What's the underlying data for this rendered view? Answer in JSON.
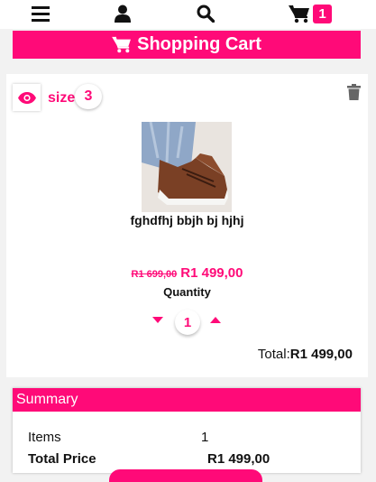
{
  "topbar": {
    "icons": [
      "menu-icon",
      "user-icon",
      "search-icon",
      "cart-icon"
    ],
    "cart_count": "1"
  },
  "cart_header": {
    "title": "Shopping Cart",
    "icon": "cart-icon"
  },
  "item": {
    "size_label": "size",
    "size_value": "3",
    "name": "fghdfhj bbjh bj hjhj",
    "old_price": "R1 699,00",
    "new_price": "R1 499,00",
    "quantity_label": "Quantity",
    "quantity": "1",
    "total_label": "Total:",
    "total_value": "R1 499,00"
  },
  "summary": {
    "title": "Summary",
    "items_label": "Items",
    "items_value": "1",
    "total_price_label": "Total Price",
    "total_price_value": "R1 499,00"
  },
  "colors": {
    "accent": "#ff0a78",
    "background": "#f2f2f2"
  }
}
